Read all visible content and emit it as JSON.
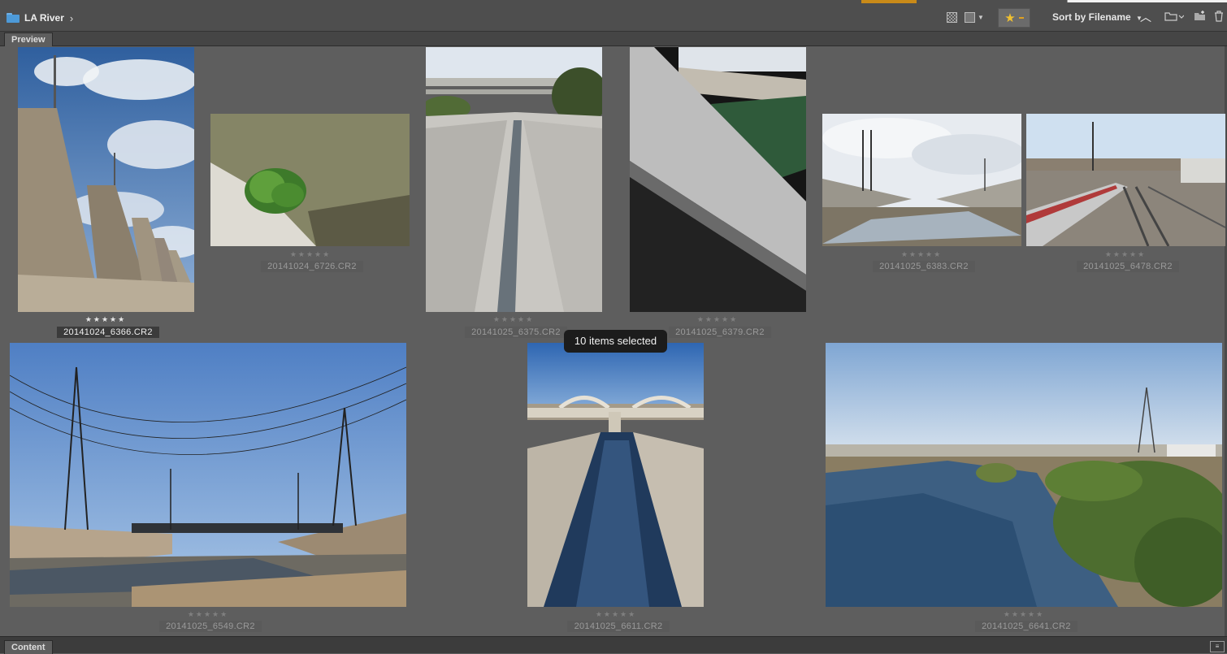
{
  "breadcrumb": {
    "folder": "LA River"
  },
  "toolbar": {
    "sort_label": "Sort by Filename",
    "accent_color": "#c98a18",
    "star_color": "#f0c030",
    "icons": [
      "thumbnail-grid-icon",
      "details-view-icon",
      "star-filter-icon",
      "sort-ascending-icon",
      "open-folder-icon",
      "new-folder-icon",
      "trash-icon"
    ]
  },
  "panels": {
    "top_tab": "Preview",
    "bottom_tab": "Content"
  },
  "tooltip": "10 items selected",
  "thumbnails": [
    {
      "filename": "20141024_6366.CR2",
      "rating_marks": "★★★★★",
      "selected": true
    },
    {
      "filename": "20141024_6726.CR2",
      "rating_marks": "★★★★★",
      "selected": false
    },
    {
      "filename": "20141025_6375.CR2",
      "rating_marks": "★★★★★",
      "selected": false
    },
    {
      "filename": "20141025_6379.CR2",
      "rating_marks": "★★★★★",
      "selected": false
    },
    {
      "filename": "20141025_6383.CR2",
      "rating_marks": "★★★★★",
      "selected": false
    },
    {
      "filename": "20141025_6478.CR2",
      "rating_marks": "★★★★★",
      "selected": false
    },
    {
      "filename": "20141025_6549.CR2",
      "rating_marks": "★★★★★",
      "selected": false
    },
    {
      "filename": "20141025_6611.CR2",
      "rating_marks": "★★★★★",
      "selected": false
    },
    {
      "filename": "20141025_6641.CR2",
      "rating_marks": "★★★★★",
      "selected": false
    }
  ]
}
